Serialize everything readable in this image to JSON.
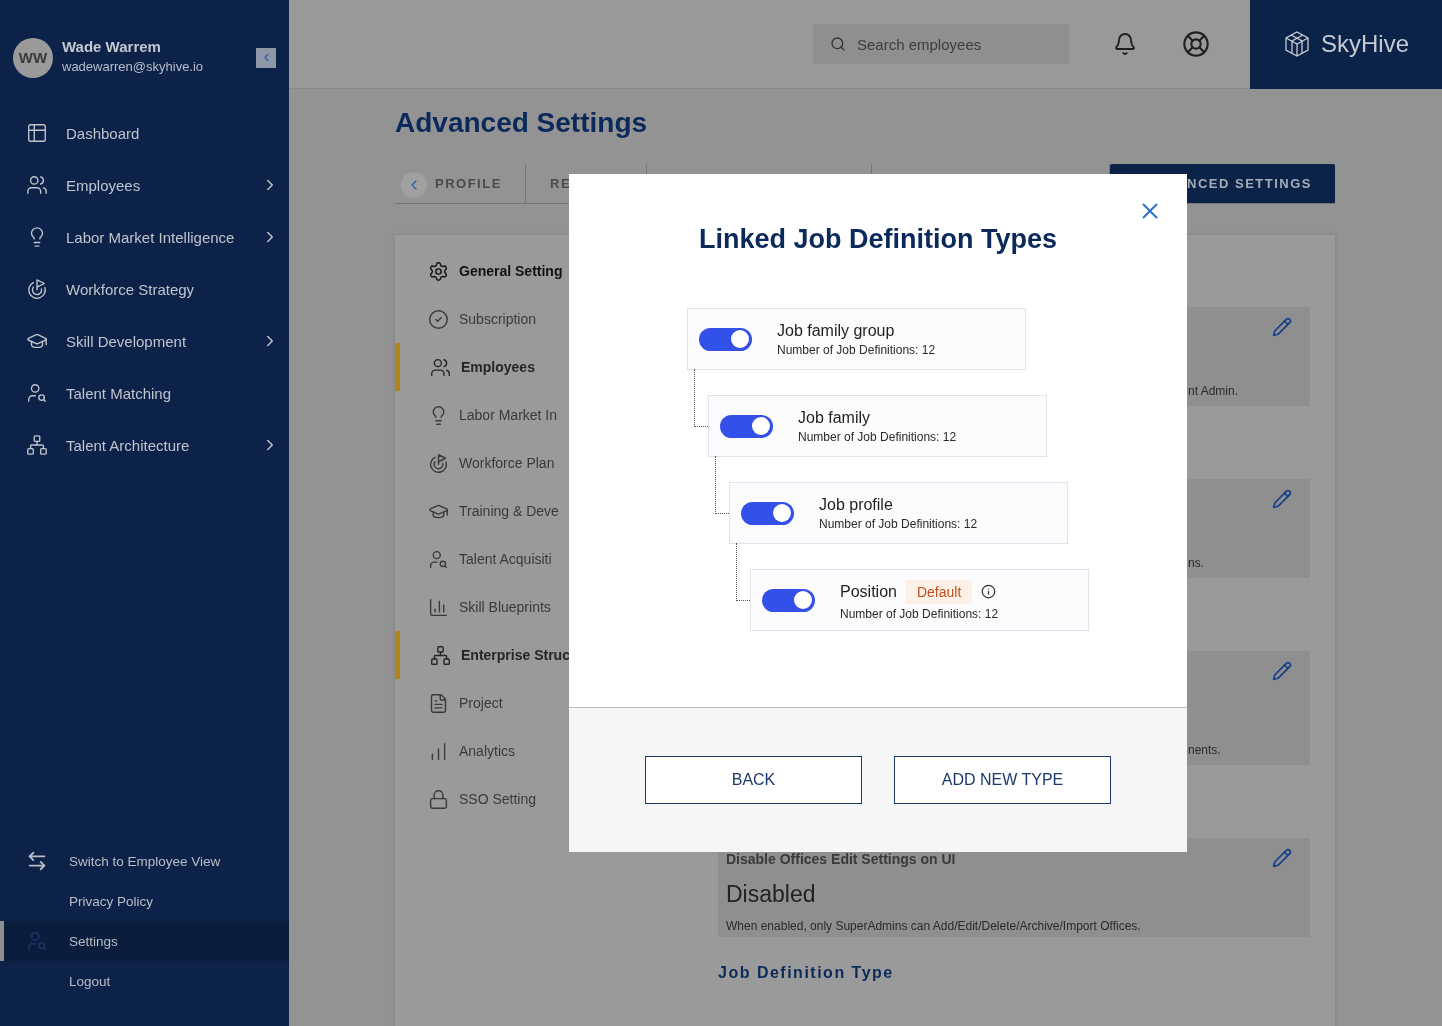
{
  "sidebar": {
    "user": {
      "initials": "WW",
      "name": "Wade Warrem",
      "email": "wadewarren@skyhive.io"
    },
    "nav": [
      {
        "label": "Dashboard",
        "has_submenu": false
      },
      {
        "label": "Employees",
        "has_submenu": true
      },
      {
        "label": "Labor Market Intelligence",
        "has_submenu": true
      },
      {
        "label": "Workforce Strategy",
        "has_submenu": false
      },
      {
        "label": "Skill Development",
        "has_submenu": true
      },
      {
        "label": "Talent Matching",
        "has_submenu": false
      },
      {
        "label": "Talent Architecture",
        "has_submenu": true
      }
    ],
    "footer": [
      {
        "label": "Switch to Employee View",
        "selected": false
      },
      {
        "label": "Privacy Policy",
        "selected": false
      },
      {
        "label": "Settings",
        "selected": true
      },
      {
        "label": "Logout",
        "selected": false
      }
    ]
  },
  "header": {
    "search": {
      "placeholder": "Search employees"
    },
    "brand": "SkyHive"
  },
  "page": {
    "title": "Advanced Settings",
    "tabs": [
      {
        "label": "PROFILE",
        "selected": false
      },
      {
        "label": "RE",
        "selected": false
      },
      {
        "label": "NCED SETTINGS",
        "selected": true
      }
    ],
    "menu": [
      {
        "label": "General Setting",
        "kind": "heading",
        "marked": false
      },
      {
        "label": "Subscription",
        "kind": "item",
        "marked": false
      },
      {
        "label": "Employees",
        "kind": "item",
        "marked": true
      },
      {
        "label": "Labor Market In",
        "kind": "item",
        "marked": false
      },
      {
        "label": "Workforce Plan",
        "kind": "item",
        "marked": false
      },
      {
        "label": "Training & Deve",
        "kind": "item",
        "marked": false
      },
      {
        "label": "Talent Acquisiti",
        "kind": "item",
        "marked": false
      },
      {
        "label": "Skill Blueprints",
        "kind": "item",
        "marked": false
      },
      {
        "label": "Enterprise Struc",
        "kind": "item",
        "marked": true
      },
      {
        "label": "Project",
        "kind": "item",
        "marked": false
      },
      {
        "label": "Analytics",
        "kind": "item",
        "marked": false
      },
      {
        "label": "SSO Setting",
        "kind": "item",
        "marked": false
      }
    ],
    "settings": [
      {
        "kind": "partial",
        "description": "nt Admin."
      },
      {
        "kind": "partial",
        "description": "ns."
      },
      {
        "kind": "partial",
        "description": "nents."
      },
      {
        "kind": "full",
        "title": "Disable Offices Edit Settings on UI",
        "value": "Disabled",
        "description": "When enabled, only SuperAdmins can Add/Edit/Delete/Archive/Import Offices."
      }
    ],
    "section_heading": "Job Definition Type"
  },
  "modal": {
    "title": "Linked Job Definition Types",
    "types": [
      {
        "name": "Job family group",
        "count": "Number of Job Definitions: 12",
        "on": true,
        "children": [
          {
            "name": "Job family",
            "count": "Number of Job Definitions: 12",
            "on": true,
            "children": [
              {
                "name": "Job profile",
                "count": "Number of Job Definitions: 12",
                "on": true,
                "children": [
                  {
                    "name": "Position",
                    "badge": "Default",
                    "count": "Number of Job Definitions: 12",
                    "on": true
                  }
                ]
              }
            ]
          }
        ]
      }
    ],
    "buttons": [
      "BACK",
      "ADD NEW TYPE"
    ]
  }
}
